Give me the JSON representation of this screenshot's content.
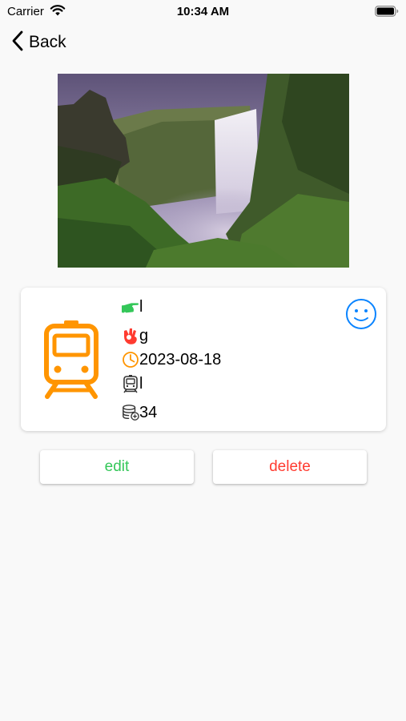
{
  "status_bar": {
    "carrier": "Carrier",
    "time": "10:34 AM"
  },
  "nav": {
    "back_label": "Back"
  },
  "record": {
    "field1": "l",
    "field2": "g",
    "date": "2023-08-18",
    "transport": "l",
    "amount": "34"
  },
  "actions": {
    "edit_label": "edit",
    "delete_label": "delete"
  },
  "colors": {
    "train": "#ff9500",
    "pointer": "#34c759",
    "hand": "#ff3b30",
    "clock": "#ff9500",
    "smile": "#0a84ff",
    "edit": "#34c759",
    "delete": "#ff3b30"
  },
  "icons": [
    "wifi-icon",
    "battery-icon",
    "chevron-left-icon",
    "train-icon",
    "pointing-hand-icon",
    "ok-hand-icon",
    "clock-icon",
    "train-small-icon",
    "coins-icon",
    "smiley-icon"
  ]
}
